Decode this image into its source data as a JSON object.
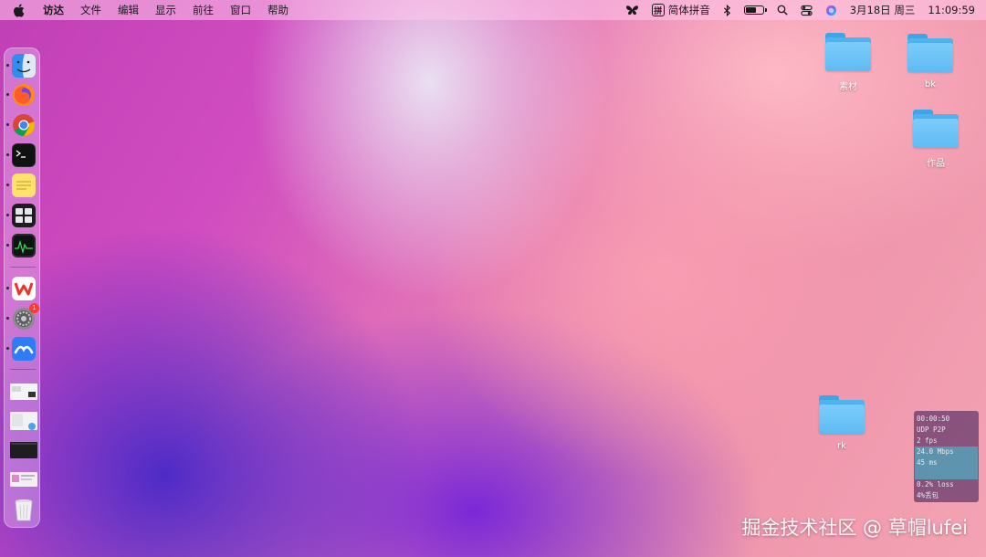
{
  "menubar": {
    "app_name": "访达",
    "menus": [
      "文件",
      "编辑",
      "显示",
      "前往",
      "窗口",
      "帮助"
    ],
    "input_method": {
      "glyph": "拼",
      "label": "简体拼音"
    },
    "datetime": {
      "date": "3月18日 周三",
      "time": "11:09:59"
    },
    "battery_level": 0.6,
    "status_icons": [
      "butterfly-icon",
      "bluetooth-icon",
      "battery-icon",
      "search-icon",
      "control-center-icon",
      "siri-icon"
    ]
  },
  "dock": {
    "apps": [
      {
        "name": "finder",
        "running": true
      },
      {
        "name": "firefox",
        "running": true
      },
      {
        "name": "chrome",
        "running": true
      },
      {
        "name": "terminal",
        "running": true
      },
      {
        "name": "stickies",
        "running": true
      },
      {
        "name": "mission-control",
        "running": true
      },
      {
        "name": "activity-monitor",
        "running": true
      },
      {
        "name": "wps-office",
        "running": true
      },
      {
        "name": "system-preferences",
        "running": true,
        "badge": "1"
      },
      {
        "name": "feishu",
        "running": true
      },
      {
        "name": "window-thumbnail-1",
        "running": false
      },
      {
        "name": "window-thumbnail-2",
        "running": false
      },
      {
        "name": "window-thumbnail-3",
        "running": false
      },
      {
        "name": "window-thumbnail-4",
        "running": false
      },
      {
        "name": "trash",
        "running": false
      }
    ]
  },
  "desktop": {
    "folders": [
      {
        "label": "素材"
      },
      {
        "label": "bk"
      },
      {
        "label": "作品"
      },
      {
        "label": "rk"
      }
    ]
  },
  "stats_overlay": {
    "lines": [
      "00:00:50",
      "UDP P2P",
      "2 fps",
      "24.0 Mbps",
      "45 ms",
      "0.2% loss",
      "4%丢包"
    ]
  },
  "watermark": "掘金技术社区 @ 草帽lufei",
  "colors": {
    "folder_blue": "#5fbbf4",
    "badge_red": "#ff3b30"
  }
}
